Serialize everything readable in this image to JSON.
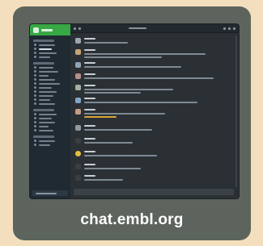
{
  "caption": "chat.embl.org",
  "colors": {
    "background": "#f3dfbd",
    "card": "#5c645d",
    "screen_main": "#2b3035",
    "sidebar": "#1f2a33",
    "workspace_header": "#37a844"
  }
}
